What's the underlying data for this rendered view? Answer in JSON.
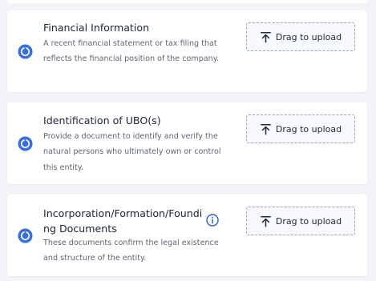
{
  "colors": {
    "accent": "#3a6fd8",
    "card_background": "#ffffff",
    "page_background": "#f2f4f8",
    "title_text": "#1c2436",
    "description_text": "#5f6672",
    "upload_border": "#9aa4b2"
  },
  "documents": [
    {
      "title": "Financial Information",
      "description": "A recent financial statement or tax filing that reflects the financial position of the company.",
      "upload_label": "Drag to upload",
      "status_icon": "circular-status-icon",
      "upload_icon": "upload-arrow-icon"
    },
    {
      "title": "Identification of UBO(s)",
      "description": "Provide a document to identify and verify the natural persons who ultimately own or control this entity.",
      "upload_label": "Drag to upload",
      "status_icon": "circular-status-icon",
      "upload_icon": "upload-arrow-icon"
    },
    {
      "title": "Incorporation/Formation/Founding Documents",
      "description": "These documents confirm the legal existence and structure of the entity.",
      "upload_label": "Drag to upload",
      "status_icon": "circular-status-icon",
      "upload_icon": "upload-arrow-icon",
      "has_info_icon": true,
      "info_icon": "info-icon"
    }
  ]
}
